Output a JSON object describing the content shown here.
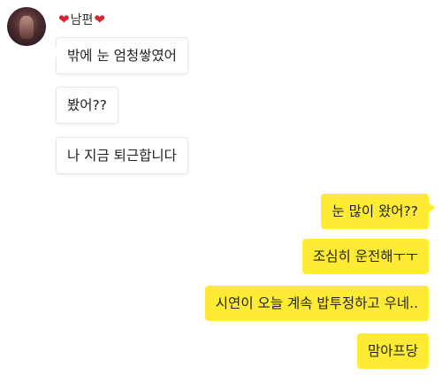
{
  "sender": {
    "name": "남편",
    "heart": "❤"
  },
  "incoming": [
    "밖에 눈 엄청쌓였어",
    "봤어??",
    "나 지금 퇴근합니다"
  ],
  "outgoing": [
    "눈 많이 왔어??",
    "조심히 운전해ㅜㅜ",
    "시연이 오늘 계속 밥투정하고 우네..",
    "맘아프당"
  ],
  "colors": {
    "outgoing_bubble": "#ffeb33",
    "incoming_bubble": "#ffffff",
    "heart": "#d9232e"
  }
}
